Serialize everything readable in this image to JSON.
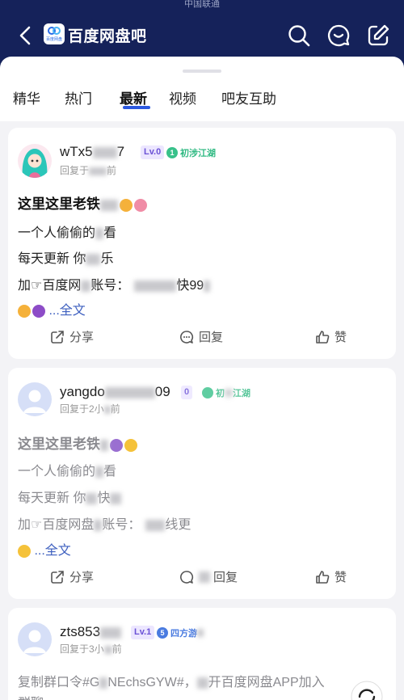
{
  "status_bar": {
    "text": "中国联通"
  },
  "header": {
    "app_badge_text": "百度网盘",
    "title": "百度网盘吧"
  },
  "tabs": [
    {
      "label": "精华"
    },
    {
      "label": "热门"
    },
    {
      "label": "最新"
    },
    {
      "label": "视频"
    },
    {
      "label": "吧友互助"
    }
  ],
  "posts": [
    {
      "username": "wTx5",
      "username_tail": "7",
      "level": "Lv.0",
      "rank_num": "1",
      "rank": "初涉江湖",
      "time": "回复于",
      "time_tail": "前",
      "title": "这里这里老铁",
      "lines": [
        "一个人偷偷的",
        "每天更新 你",
        "加☞百度网",
        "账号：",
        "快99"
      ],
      "line2_tail": "看",
      "line3_tail": "乐",
      "more": "...全文",
      "actions": {
        "share": "分享",
        "reply": "回复",
        "like": "赞"
      }
    },
    {
      "username": "yangdo",
      "username_tail": "09",
      "level": "0",
      "rank": "初",
      "rank_tail": "江湖",
      "time": "回复于2小",
      "time_tail": "前",
      "title": "这里这里老铁",
      "lines": [
        "一个人偷偷的",
        "每天更新 你",
        "快",
        "加☞百度网盘",
        "账号：",
        "线更"
      ],
      "line1_tail": "看",
      "more": "...全文",
      "actions": {
        "share": "分享",
        "reply": "回复",
        "like": "赞"
      }
    },
    {
      "username": "zts853",
      "level": "Lv.1",
      "rank_num": "5",
      "rank": "四方游",
      "time": "回复于3小",
      "time_tail": "前",
      "line": "复制群口令#G",
      "line_mid": "NEchsGYW#，",
      "line_mid2": "开",
      "line_tail": "百度网盘APP加入",
      "line_next": "群聊"
    }
  ]
}
